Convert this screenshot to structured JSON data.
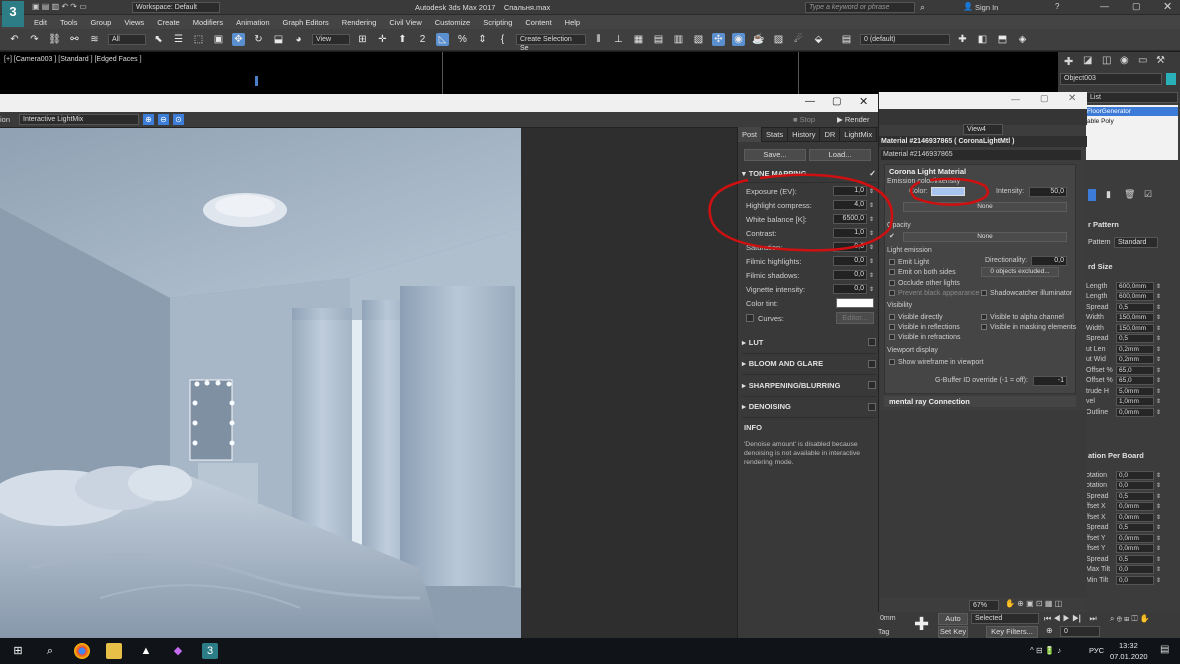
{
  "app": {
    "title": "Autodesk 3ds Max 2017",
    "file": "Спальня.max",
    "workspace": "Workspace: Default",
    "search_placeholder": "Type a keyword or phrase",
    "sign_in": "Sign In"
  },
  "menu": [
    "Edit",
    "Tools",
    "Group",
    "Views",
    "Create",
    "Modifiers",
    "Animation",
    "Graph Editors",
    "Rendering",
    "Civil View",
    "Customize",
    "Scripting",
    "Content",
    "Help"
  ],
  "toolbar": {
    "filter": "All",
    "view": "View",
    "selection_set": "Create Selection Se",
    "layer": "0 (default)"
  },
  "viewport_label": "[+] [Camera003 ] [Standard ] [Edged Faces ]",
  "object_name": "Object003",
  "vfb": {
    "left_clip": "ion",
    "mode": "Interactive LightMix",
    "stop": "Stop",
    "render": "Render",
    "tabs": [
      "Post",
      "Stats",
      "History",
      "DR",
      "LightMix"
    ],
    "save": "Save...",
    "load": "Load...",
    "tone_mapping": "TONE MAPPING",
    "params": [
      {
        "label": "Exposure (EV):",
        "value": "1,0"
      },
      {
        "label": "Highlight compress:",
        "value": "4,0"
      },
      {
        "label": "White balance [K]:",
        "value": "6500,0"
      },
      {
        "label": "Contrast:",
        "value": "1,0"
      },
      {
        "label": "Saturation:",
        "value": "0,0"
      },
      {
        "label": "Filmic highlights:",
        "value": "0,0"
      },
      {
        "label": "Filmic shadows:",
        "value": "0,0"
      },
      {
        "label": "Vignette intensity:",
        "value": "0,0"
      }
    ],
    "color_tint": "Color tint:",
    "curves": "Curves:",
    "editor": "Editor...",
    "sections": [
      "LUT",
      "BLOOM AND GLARE",
      "SHARPENING/BLURRING",
      "DENOISING"
    ],
    "info_title": "INFO",
    "info_text": "'Denoise amount' is disabled because denoising is not available in interactive rendering mode."
  },
  "material": {
    "view": "View4",
    "header": "Material #2146937865  ( CoronaLightMtl )",
    "name": "Material #2146937865",
    "panel_title": "Corona Light Material",
    "emission_label": "Emission color/intensity",
    "color_label": "Color:",
    "intensity_label": "Intensity:",
    "intensity": "50,0",
    "none1": "None",
    "opacity": "Opacity",
    "none2": "None",
    "light_emission": "Light emission",
    "emit_light": "Emit Light",
    "directionality_label": "Directionality:",
    "directionality": "0,0",
    "emit_both": "Emit on both sides",
    "objects_excluded": "0 objects excluded...",
    "occlude": "Occlude other lights",
    "prevent_black": "Prevent black appearance",
    "shadowcatcher": "Shadowcatcher illuminator",
    "visibility": "Visibility",
    "vis_direct": "Visible directly",
    "vis_alpha": "Visible to alpha channel",
    "vis_refl": "Visible in reflections",
    "vis_mask": "Visible in masking elements",
    "vis_refr": "Visible in refractions",
    "viewport_display": "Viewport display",
    "show_wire": "Show wireframe in viewport",
    "gbuffer": "G-Buffer ID override (-1 = off):",
    "gbuffer_val": "-1",
    "mental_ray": "mental ray Connection",
    "emission_color": "#a8c4f0"
  },
  "modifier": {
    "list": "List",
    "items": [
      "FloorGenerator",
      "able Poly"
    ],
    "pattern_title": "r Pattern",
    "pattern_label": "Pattern",
    "pattern_value": "Standard",
    "size_title": "rd Size",
    "size_rows": [
      {
        "label": "Length",
        "value": "600,0mm"
      },
      {
        "label": "Length",
        "value": "600,0mm"
      },
      {
        "label": "Spread",
        "value": "0,5"
      },
      {
        "label": "Width",
        "value": "150,0mm"
      },
      {
        "label": "Width",
        "value": "150,0mm"
      },
      {
        "label": "Spread",
        "value": "0,5"
      },
      {
        "label": "ut Len",
        "value": "0,2mm"
      },
      {
        "label": "ut Wid",
        "value": "0,2mm"
      },
      {
        "label": "Offset %",
        "value": "65,0"
      },
      {
        "label": "Offset %",
        "value": "65,0"
      },
      {
        "label": "trude H",
        "value": "5,0mm"
      },
      {
        "label": "vel",
        "value": "1,0mm"
      },
      {
        "label": "Outline",
        "value": "0,0mm"
      }
    ],
    "rotation_title": "ation Per Board",
    "rot_rows": [
      {
        "label": "otation",
        "value": "0,0"
      },
      {
        "label": "otation",
        "value": "0,0"
      },
      {
        "label": "Spread",
        "value": "0,5"
      },
      {
        "label": "ffset X",
        "value": "0,0mm"
      },
      {
        "label": "ffset X",
        "value": "0,0mm"
      },
      {
        "label": "Spread",
        "value": "0,5"
      },
      {
        "label": "ffset Y",
        "value": "0,0mm"
      },
      {
        "label": "ffset Y",
        "value": "0,0mm"
      },
      {
        "label": "Spread",
        "value": "0,5"
      },
      {
        "label": "Max Tilt",
        "value": "0,0"
      },
      {
        "label": "Min Tilt",
        "value": "0,0"
      }
    ]
  },
  "status": {
    "zoom": "67%",
    "mm": "0mm",
    "autokey": "Auto Key",
    "selected": "Selected",
    "setkey": "Set Key",
    "keyfilters": "Key Filters...",
    "frame": "0",
    "tag": "Tag"
  },
  "taskbar": {
    "lang": "РУС",
    "time": "13:32",
    "date": "07.01.2020"
  },
  "colors": {
    "accent": "#5a8fd0",
    "annotation": "#d01010"
  }
}
